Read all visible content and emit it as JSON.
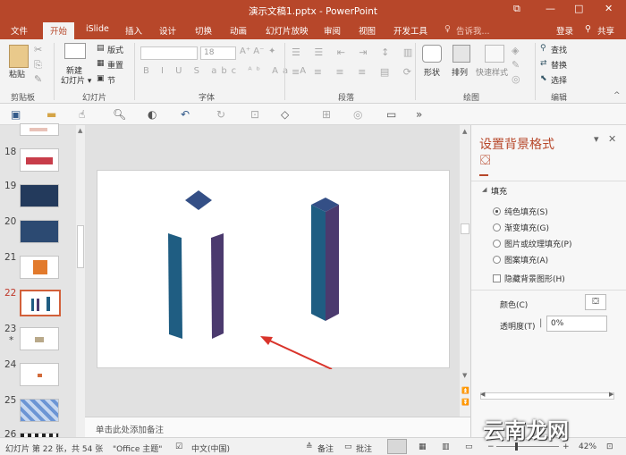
{
  "titlebar": {
    "title": "演示文稿1.pptx - PowerPoint",
    "restore": "⧉",
    "min": "—",
    "max": "□",
    "close": "✕"
  },
  "tabs": {
    "items": [
      "文件",
      "开始",
      "iSlide",
      "插入",
      "设计",
      "切换",
      "动画",
      "幻灯片放映",
      "审阅",
      "视图",
      "开发工具"
    ],
    "tellme": "告诉我...",
    "login": "登录",
    "share": "共享"
  },
  "ribbon": {
    "paste": "粘贴",
    "clipboard": "剪贴板",
    "new_slide": "新建\n幻灯片",
    "new_slide_l1": "新建",
    "new_slide_l2": "幻灯片 ▾",
    "layout": "版式",
    "reset": "重置",
    "section": "节",
    "slides_group": "幻灯片",
    "font_size": "18",
    "font_group": "字体",
    "para_group": "段落",
    "shape": "形状",
    "arrange": "排列",
    "quick_style": "快速样式",
    "draw_group": "绘图",
    "find": "查找",
    "replace": "替换",
    "select": "选择",
    "edit_group": "编辑"
  },
  "thumbs": {
    "items": [
      {
        "n": "18"
      },
      {
        "n": "19"
      },
      {
        "n": "20"
      },
      {
        "n": "21"
      },
      {
        "n": "22"
      },
      {
        "n": "23"
      },
      {
        "n": "24"
      },
      {
        "n": "25"
      },
      {
        "n": "26"
      }
    ],
    "star": "*"
  },
  "notes": "单击此处添加备注",
  "pane": {
    "title": "设置背景格式",
    "fill_section": "填充",
    "options": [
      "纯色填充(S)",
      "渐变填充(G)",
      "图片或纹理填充(P)",
      "图案填充(A)"
    ],
    "hide_bg": "隐藏背景图形(H)",
    "color_label": "颜色(C)",
    "transparency_label": "透明度(T)",
    "transparency_value": "0%"
  },
  "status": {
    "slide_info": "幻灯片 第 22 张，共 54 张",
    "theme": "\"Office 主题\"",
    "lang": "中文(中国)",
    "notes": "备注",
    "comments": "批注",
    "zoom": "42%"
  },
  "watermark": "云南龙网",
  "colors": {
    "accent": "#b7472a",
    "shape_blue": "#1f5d82",
    "shape_purple": "#4b3a6e",
    "arrow": "#d9342b"
  }
}
